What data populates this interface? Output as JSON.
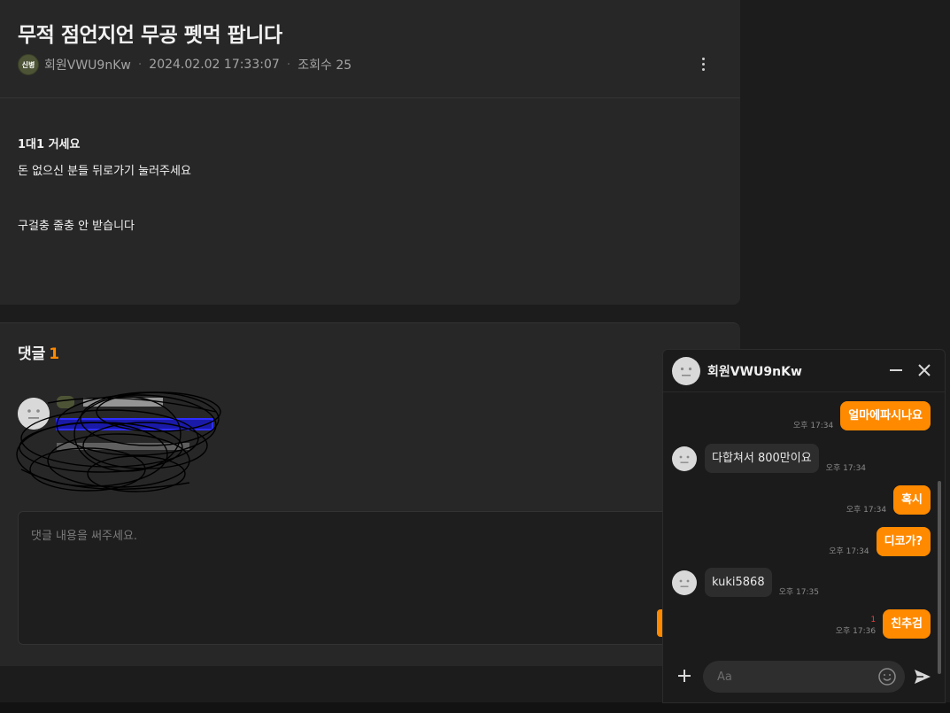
{
  "post": {
    "title": "무적 점언지언 무공 펫먹 팝니다",
    "author_badge": "신병",
    "author": "회원VWU9nKw",
    "date": "2024.02.02 17:33:07",
    "views": "조회수 25",
    "body": [
      "1대1 거세요",
      "돈 없으신 분들 뒤로가기 눌러주세요",
      "구걸충 줄충 안 받습니다"
    ]
  },
  "comments": {
    "label": "댓글",
    "count": "1",
    "placeholder": "댓글 내용을 써주세요."
  },
  "chat": {
    "partner_name": "회원VWU9nKw",
    "messages": [
      {
        "dir": "out",
        "text": "얼마에파시나요",
        "time": "오후 17:34"
      },
      {
        "dir": "in",
        "text": "다합쳐서 800만이요",
        "time": "오후 17:34"
      },
      {
        "dir": "out",
        "text": "혹시",
        "time": "오후 17:34"
      },
      {
        "dir": "out",
        "text": "디코가?",
        "time": "오후 17:34"
      },
      {
        "dir": "in",
        "text": "kuki5868",
        "time": "오후 17:35"
      },
      {
        "dir": "out",
        "text": "친추검",
        "time": "오후 17:36",
        "unread": "1"
      }
    ],
    "input_placeholder": "Aa"
  },
  "colors": {
    "accent": "#ff8a00",
    "unread": "#ff3b3b",
    "background": "#1c1c1c",
    "card": "#272727"
  }
}
